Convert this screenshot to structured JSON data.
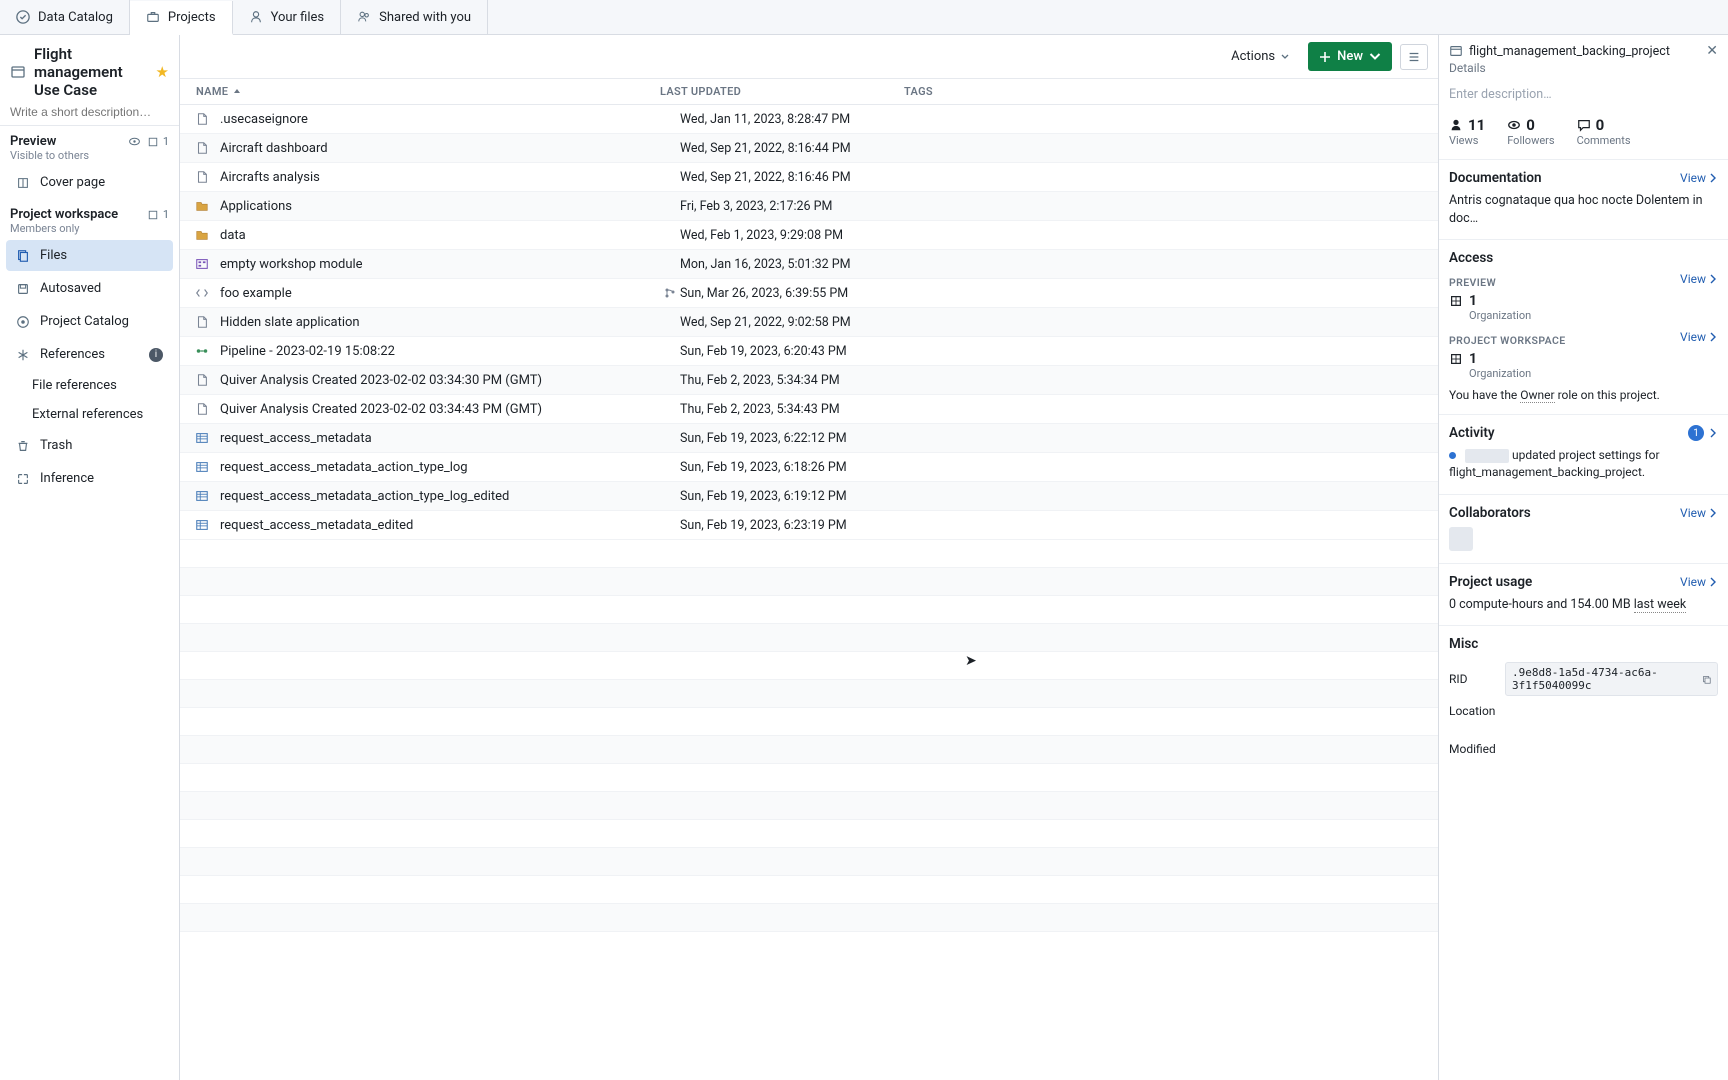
{
  "topTabs": [
    {
      "id": "data-catalog",
      "label": "Data Catalog"
    },
    {
      "id": "projects",
      "label": "Projects",
      "active": true
    },
    {
      "id": "your-files",
      "label": "Your files"
    },
    {
      "id": "shared",
      "label": "Shared with you"
    }
  ],
  "project": {
    "title": "Flight management Use Case",
    "descPlaceholder": "Write a short description…"
  },
  "sidebar": {
    "preview": {
      "title": "Preview",
      "sub": "Visible to others",
      "badge": "1"
    },
    "coverPage": "Cover page",
    "workspace": {
      "title": "Project workspace",
      "sub": "Members only",
      "badge": "1"
    },
    "nav": [
      {
        "id": "files",
        "label": "Files",
        "selected": true
      },
      {
        "id": "autosaved",
        "label": "Autosaved"
      },
      {
        "id": "project-catalog",
        "label": "Project Catalog"
      },
      {
        "id": "references",
        "label": "References",
        "info": true,
        "children": [
          "File references",
          "External references"
        ]
      },
      {
        "id": "trash",
        "label": "Trash"
      },
      {
        "id": "inference",
        "label": "Inference"
      }
    ]
  },
  "toolbar": {
    "actions": "Actions",
    "new": "New"
  },
  "table": {
    "headers": {
      "name": "NAME",
      "updated": "LAST UPDATED",
      "tags": "TAGS"
    },
    "rows": [
      {
        "icon": "file",
        "name": ".usecaseignore",
        "updated": "Wed, Jan 11, 2023, 8:28:47 PM"
      },
      {
        "icon": "file",
        "name": "Aircraft dashboard",
        "updated": "Wed, Sep 21, 2022, 8:16:44 PM"
      },
      {
        "icon": "file",
        "name": "Aircrafts analysis",
        "updated": "Wed, Sep 21, 2022, 8:16:46 PM"
      },
      {
        "icon": "folder",
        "name": "Applications",
        "updated": "Fri, Feb 3, 2023, 2:17:26 PM"
      },
      {
        "icon": "folder",
        "name": "data",
        "updated": "Wed, Feb 1, 2023, 9:29:08 PM"
      },
      {
        "icon": "module",
        "name": "empty workshop module",
        "updated": "Mon, Jan 16, 2023, 5:01:32 PM"
      },
      {
        "icon": "code",
        "name": "foo example",
        "updated": "Sun, Mar 26, 2023, 6:39:55 PM",
        "branch": true
      },
      {
        "icon": "file",
        "name": "Hidden slate application",
        "updated": "Wed, Sep 21, 2022, 9:02:58 PM"
      },
      {
        "icon": "pipeline",
        "name": "Pipeline - 2023-02-19 15:08:22",
        "updated": "Sun, Feb 19, 2023, 6:20:43 PM"
      },
      {
        "icon": "file",
        "name": "Quiver Analysis Created 2023-02-02 03:34:30 PM (GMT)",
        "updated": "Thu, Feb 2, 2023, 5:34:34 PM"
      },
      {
        "icon": "file",
        "name": "Quiver Analysis Created 2023-02-02 03:34:43 PM (GMT)",
        "updated": "Thu, Feb 2, 2023, 5:34:43 PM"
      },
      {
        "icon": "dataset",
        "name": "request_access_metadata",
        "updated": "Sun, Feb 19, 2023, 6:22:12 PM"
      },
      {
        "icon": "dataset",
        "name": "request_access_metadata_action_type_log",
        "updated": "Sun, Feb 19, 2023, 6:18:26 PM"
      },
      {
        "icon": "dataset",
        "name": "request_access_metadata_action_type_log_edited",
        "updated": "Sun, Feb 19, 2023, 6:19:12 PM"
      },
      {
        "icon": "dataset",
        "name": "request_access_metadata_edited",
        "updated": "Sun, Feb 19, 2023, 6:23:19 PM"
      }
    ]
  },
  "details": {
    "name": "flight_management_backing_project",
    "sub": "Details",
    "descPlaceholder": "Enter description…",
    "stats": {
      "views": "11",
      "viewsLabel": "Views",
      "followers": "0",
      "followersLabel": "Followers",
      "comments": "0",
      "commentsLabel": "Comments"
    },
    "doc": {
      "hd": "Documentation",
      "view": "View",
      "text": "Antris cognataque qua hoc nocte Dolentem in doc…"
    },
    "access": {
      "hd": "Access",
      "preview": "PREVIEW",
      "previewCount": "1",
      "previewOrg": "Organization",
      "workspace": "PROJECT WORKSPACE",
      "workspaceCount": "1",
      "workspaceOrg": "Organization",
      "owner_pre": "You have the ",
      "owner_role": "Owner",
      "owner_post": " role on this project."
    },
    "activity": {
      "hd": "Activity",
      "badge": "1",
      "text1": " updated project settings for flight_management_backing_project."
    },
    "collaborators": {
      "hd": "Collaborators",
      "view": "View"
    },
    "usage": {
      "hd": "Project usage",
      "view": "View",
      "text_pre": "0 compute-hours and 154.00 MB ",
      "text_link": "last week"
    },
    "misc": {
      "hd": "Misc",
      "rid": "RID",
      "ridVal": ".9e8d8-1a5d-4734-ac6a-3f1f5040099c",
      "location": "Location",
      "modified": "Modified"
    },
    "viewLabel": "View"
  }
}
